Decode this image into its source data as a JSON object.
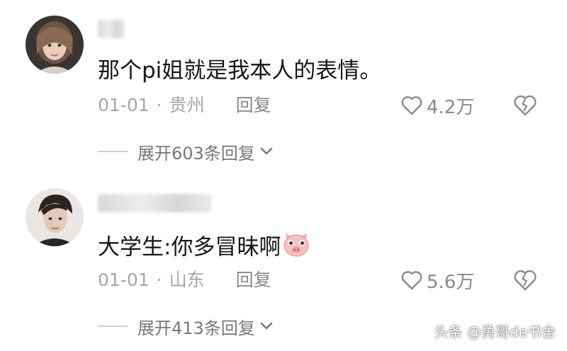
{
  "comments": [
    {
      "text": "那个pi姐就是我本人的表情。",
      "date": "01-01",
      "location": "贵州",
      "reply_label": "回复",
      "like_count": "4.2万",
      "expand_label": "展开603条回复"
    },
    {
      "text": "大学生:你多冒昧啊",
      "date": "01-01",
      "location": "山东",
      "reply_label": "回复",
      "like_count": "5.6万",
      "expand_label": "展开413条回复"
    }
  ],
  "separator": "·",
  "watermark": "头条 @勇哥de书舍",
  "colors": {
    "meta": "#a6a6a6",
    "icon": "#8a8a8a",
    "pig": "#f3b6b6"
  }
}
